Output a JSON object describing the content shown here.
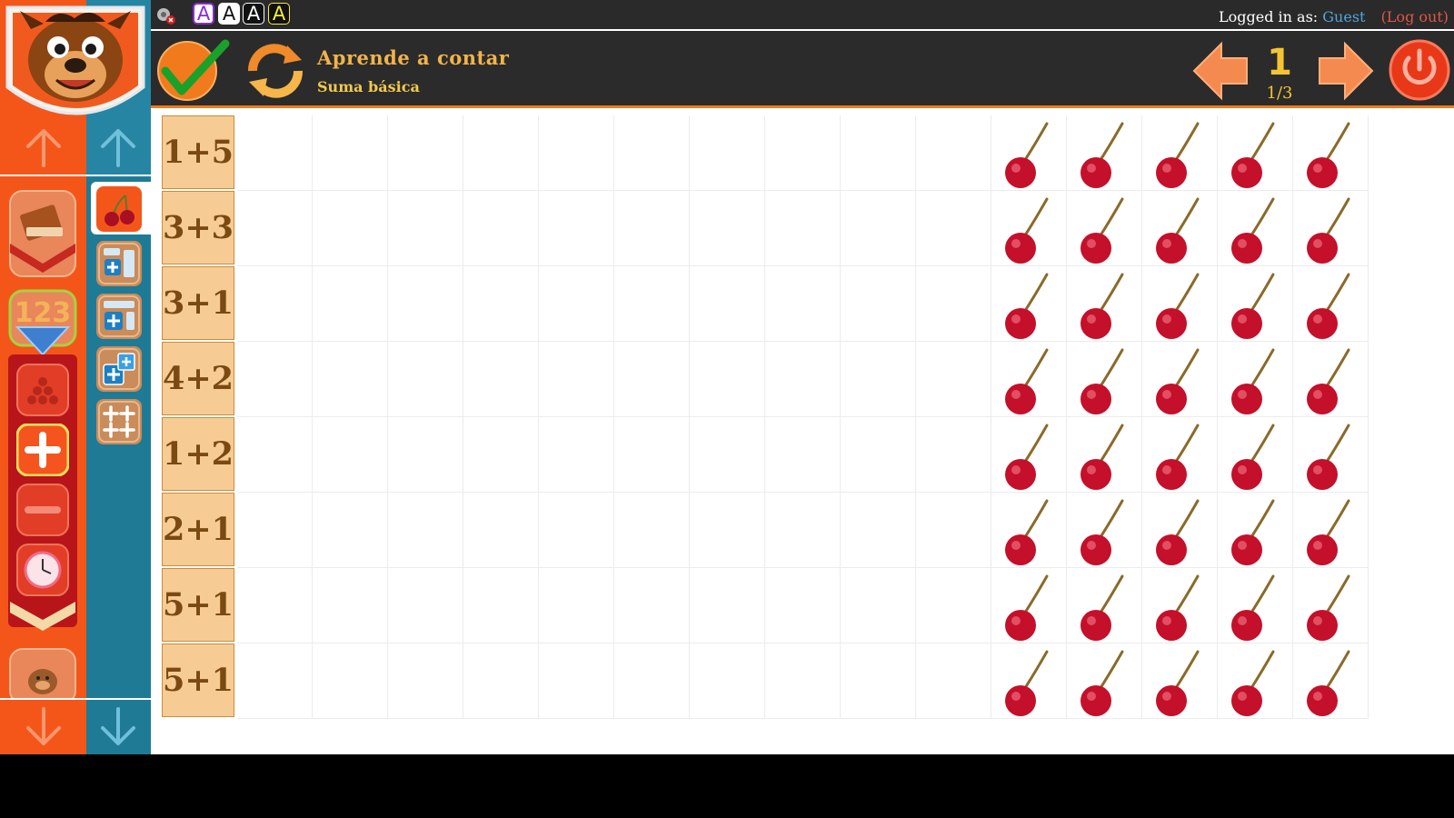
{
  "topstrip": {
    "font_buttons": [
      "A",
      "A",
      "A",
      "A"
    ],
    "login_prefix": "Logged in as:",
    "user": "Guest",
    "logout": "(Log out)"
  },
  "header": {
    "title": "Aprende a contar",
    "subtitle": "Suma básica",
    "page_number": "1",
    "page_fraction": "1/3"
  },
  "sidebar": {
    "categories": [
      "books-icon",
      "numbers-icon",
      "counting-balls-icon",
      "addition-icon",
      "subtraction-icon",
      "clock-icon",
      "mascot-icon"
    ],
    "subitems": [
      "cherries-icon",
      "addition-table-icon",
      "addition-grid-icon",
      "addition-puzzle-icon",
      "multi-addition-icon"
    ]
  },
  "exercise": {
    "rows": [
      {
        "label": "1+5",
        "cherries": 5
      },
      {
        "label": "3+3",
        "cherries": 5
      },
      {
        "label": "3+1",
        "cherries": 5
      },
      {
        "label": "4+2",
        "cherries": 5
      },
      {
        "label": "1+2",
        "cherries": 5
      },
      {
        "label": "2+1",
        "cherries": 5
      },
      {
        "label": "5+1",
        "cherries": 5
      },
      {
        "label": "5+1",
        "cherries": 5
      }
    ]
  },
  "colors": {
    "accent_orange": "#f4561a",
    "sidebar_blue": "#1f7a96",
    "title_yellow": "#f2b34a",
    "label_bg": "#f6cc94",
    "cherry_red": "#c4102a"
  }
}
